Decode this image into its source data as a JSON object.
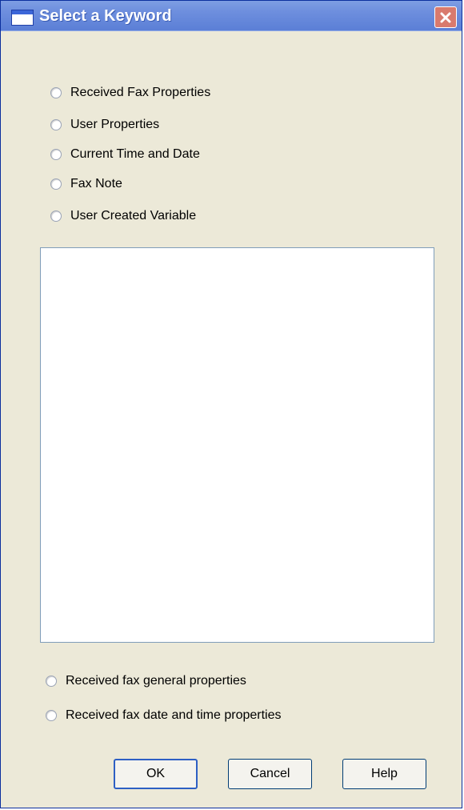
{
  "window": {
    "title": "Select a Keyword"
  },
  "radios_top": [
    {
      "label": "Received Fax Properties"
    },
    {
      "label": "User Properties"
    },
    {
      "label": "Current Time and Date"
    },
    {
      "label": "Fax Note"
    },
    {
      "label": "User Created Variable"
    }
  ],
  "radios_bottom": [
    {
      "label": "Received fax general properties"
    },
    {
      "label": "Received fax date and time properties"
    }
  ],
  "buttons": {
    "ok": "OK",
    "cancel": "Cancel",
    "help": "Help"
  },
  "colors": {
    "titlebar": "#6e8fde",
    "dialog_bg": "#ece9d8",
    "close_button": "#d97a6d"
  },
  "icons": {
    "window": "window-icon",
    "close": "close-icon"
  }
}
